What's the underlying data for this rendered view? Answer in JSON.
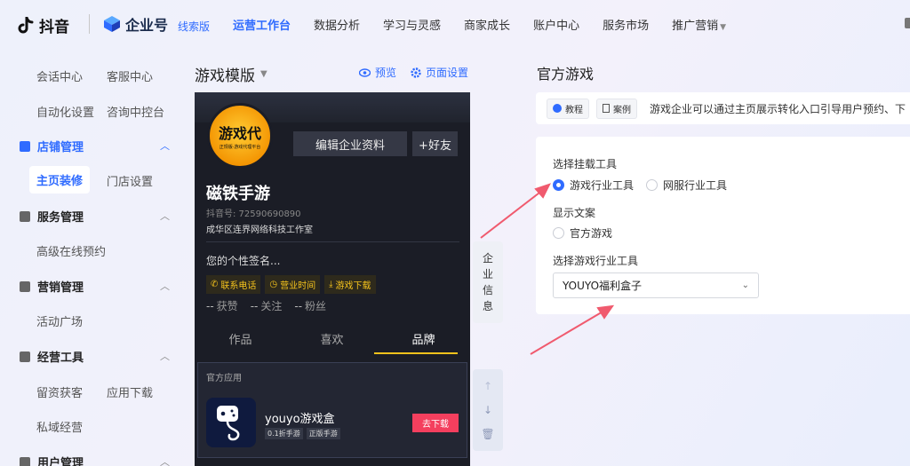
{
  "header": {
    "douyin_logo": "抖音",
    "enterprise_logo": "企业号",
    "edition": "线索版",
    "nav": [
      {
        "label": "运营工作台",
        "active": true
      },
      {
        "label": "数据分析"
      },
      {
        "label": "学习与灵感"
      },
      {
        "label": "商家成长"
      },
      {
        "label": "账户中心"
      },
      {
        "label": "服务市场"
      },
      {
        "label": "推广营销",
        "dropdown": true
      }
    ]
  },
  "sidebar": {
    "top_items": [
      "会话中心",
      "客服中心",
      "自动化设置",
      "咨询中控台"
    ],
    "groups": [
      {
        "label": "店铺管理",
        "icon": "store-icon",
        "items": [
          "主页装修",
          "门店设置"
        ]
      },
      {
        "label": "服务管理",
        "icon": "service-icon",
        "items": [
          "高级在线预约"
        ]
      },
      {
        "label": "营销管理",
        "icon": "marketing-icon",
        "items": [
          "活动广场"
        ]
      },
      {
        "label": "经营工具",
        "icon": "tools-icon",
        "items": [
          "留资获客",
          "应用下载",
          "私域经营"
        ]
      },
      {
        "label": "用户管理",
        "icon": "user-icon",
        "items": []
      }
    ],
    "active_item": "主页装修"
  },
  "preview": {
    "template_title": "游戏模版",
    "preview_label": "预览",
    "page_settings_label": "页面设置",
    "avatar_text": "游戏代",
    "avatar_subtext": "正规版·游戏代理平台",
    "edit_profile_label": "编辑企业资料",
    "add_friend_label": "+好友",
    "account_name": "磁铁手游",
    "douyin_id": "抖音号: 72590690890",
    "company": "成华区连界网络科技工作室",
    "signature": "您的个性签名...",
    "tags": [
      "联系电话",
      "营业时间",
      "游戏下载"
    ],
    "stats": [
      {
        "value": "--",
        "label": "获赞"
      },
      {
        "value": "--",
        "label": "关注"
      },
      {
        "value": "--",
        "label": "粉丝"
      }
    ],
    "tabs": [
      "作品",
      "喜欢",
      "品牌"
    ],
    "active_tab": "品牌",
    "official_app_caption": "官方应用",
    "app_name": "youyo游戏盒",
    "app_badges": [
      "0.1折手游",
      "正版手游"
    ],
    "download_label": "去下载",
    "side_tab_chars": [
      "企",
      "业",
      "信",
      "息"
    ]
  },
  "panel": {
    "title": "官方游戏",
    "tutorial_label": "教程",
    "case_label": "案例",
    "description": "游戏企业可以通过主页展示转化入口引导用户预约、下",
    "mount_tool_label": "选择挂载工具",
    "mount_tool_options": [
      "游戏行业工具",
      "网服行业工具"
    ],
    "mount_tool_selected": "游戏行业工具",
    "display_copy_label": "显示文案",
    "display_copy_options": [
      "官方游戏"
    ],
    "game_tool_label": "选择游戏行业工具",
    "game_tool_value": "YOUYO福利盒子"
  },
  "colors": {
    "accent": "#2f6bff",
    "download": "#f43f5e",
    "tag_yellow": "#f4c21c",
    "arrow_red": "#f05a6e"
  }
}
